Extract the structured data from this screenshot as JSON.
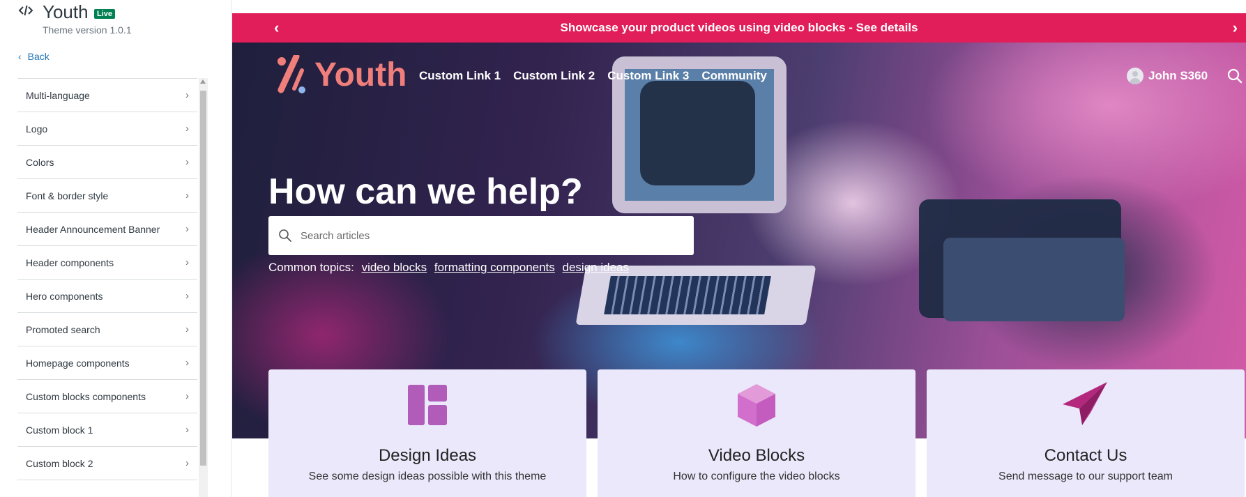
{
  "sidebar": {
    "theme_name": "Youth",
    "live_badge": "Live",
    "theme_version": "Theme version 1.0.1",
    "back_label": "Back",
    "items": [
      {
        "label": "Multi-language"
      },
      {
        "label": "Logo"
      },
      {
        "label": "Colors"
      },
      {
        "label": "Font & border style"
      },
      {
        "label": "Header Announcement Banner"
      },
      {
        "label": "Header components"
      },
      {
        "label": "Hero components"
      },
      {
        "label": "Promoted search"
      },
      {
        "label": "Homepage components"
      },
      {
        "label": "Custom blocks components"
      },
      {
        "label": "Custom block 1"
      },
      {
        "label": "Custom block 2"
      }
    ]
  },
  "announcement": {
    "text": "Showcase your product videos using video blocks - See details",
    "prev_icon": "chevron-left-icon",
    "next_icon": "chevron-right-icon"
  },
  "header": {
    "logo_text": "Youth",
    "links": [
      "Custom Link 1",
      "Custom Link 2",
      "Custom Link 3",
      "Community"
    ],
    "user_name": "John S360",
    "search_icon": "search-icon"
  },
  "hero": {
    "title": "How can we help?",
    "search_placeholder": "Search articles",
    "topics_label": "Common topics:",
    "topics": [
      "video blocks",
      "formatting components",
      "design ideas"
    ]
  },
  "cards": [
    {
      "title": "Design Ideas",
      "description": "See some design ideas possible with this theme",
      "icon": "layout-icon"
    },
    {
      "title": "Video Blocks",
      "description": "How to configure the video blocks",
      "icon": "cube-icon"
    },
    {
      "title": "Contact Us",
      "description": "Send message to our support team",
      "icon": "paper-plane-icon"
    }
  ],
  "colors": {
    "announcement_bg": "#e11d5a",
    "logo": "#f07f7b",
    "card_bg": "#ebe8fb",
    "card_icon": "#b05cb8",
    "live_badge": "#038153"
  }
}
